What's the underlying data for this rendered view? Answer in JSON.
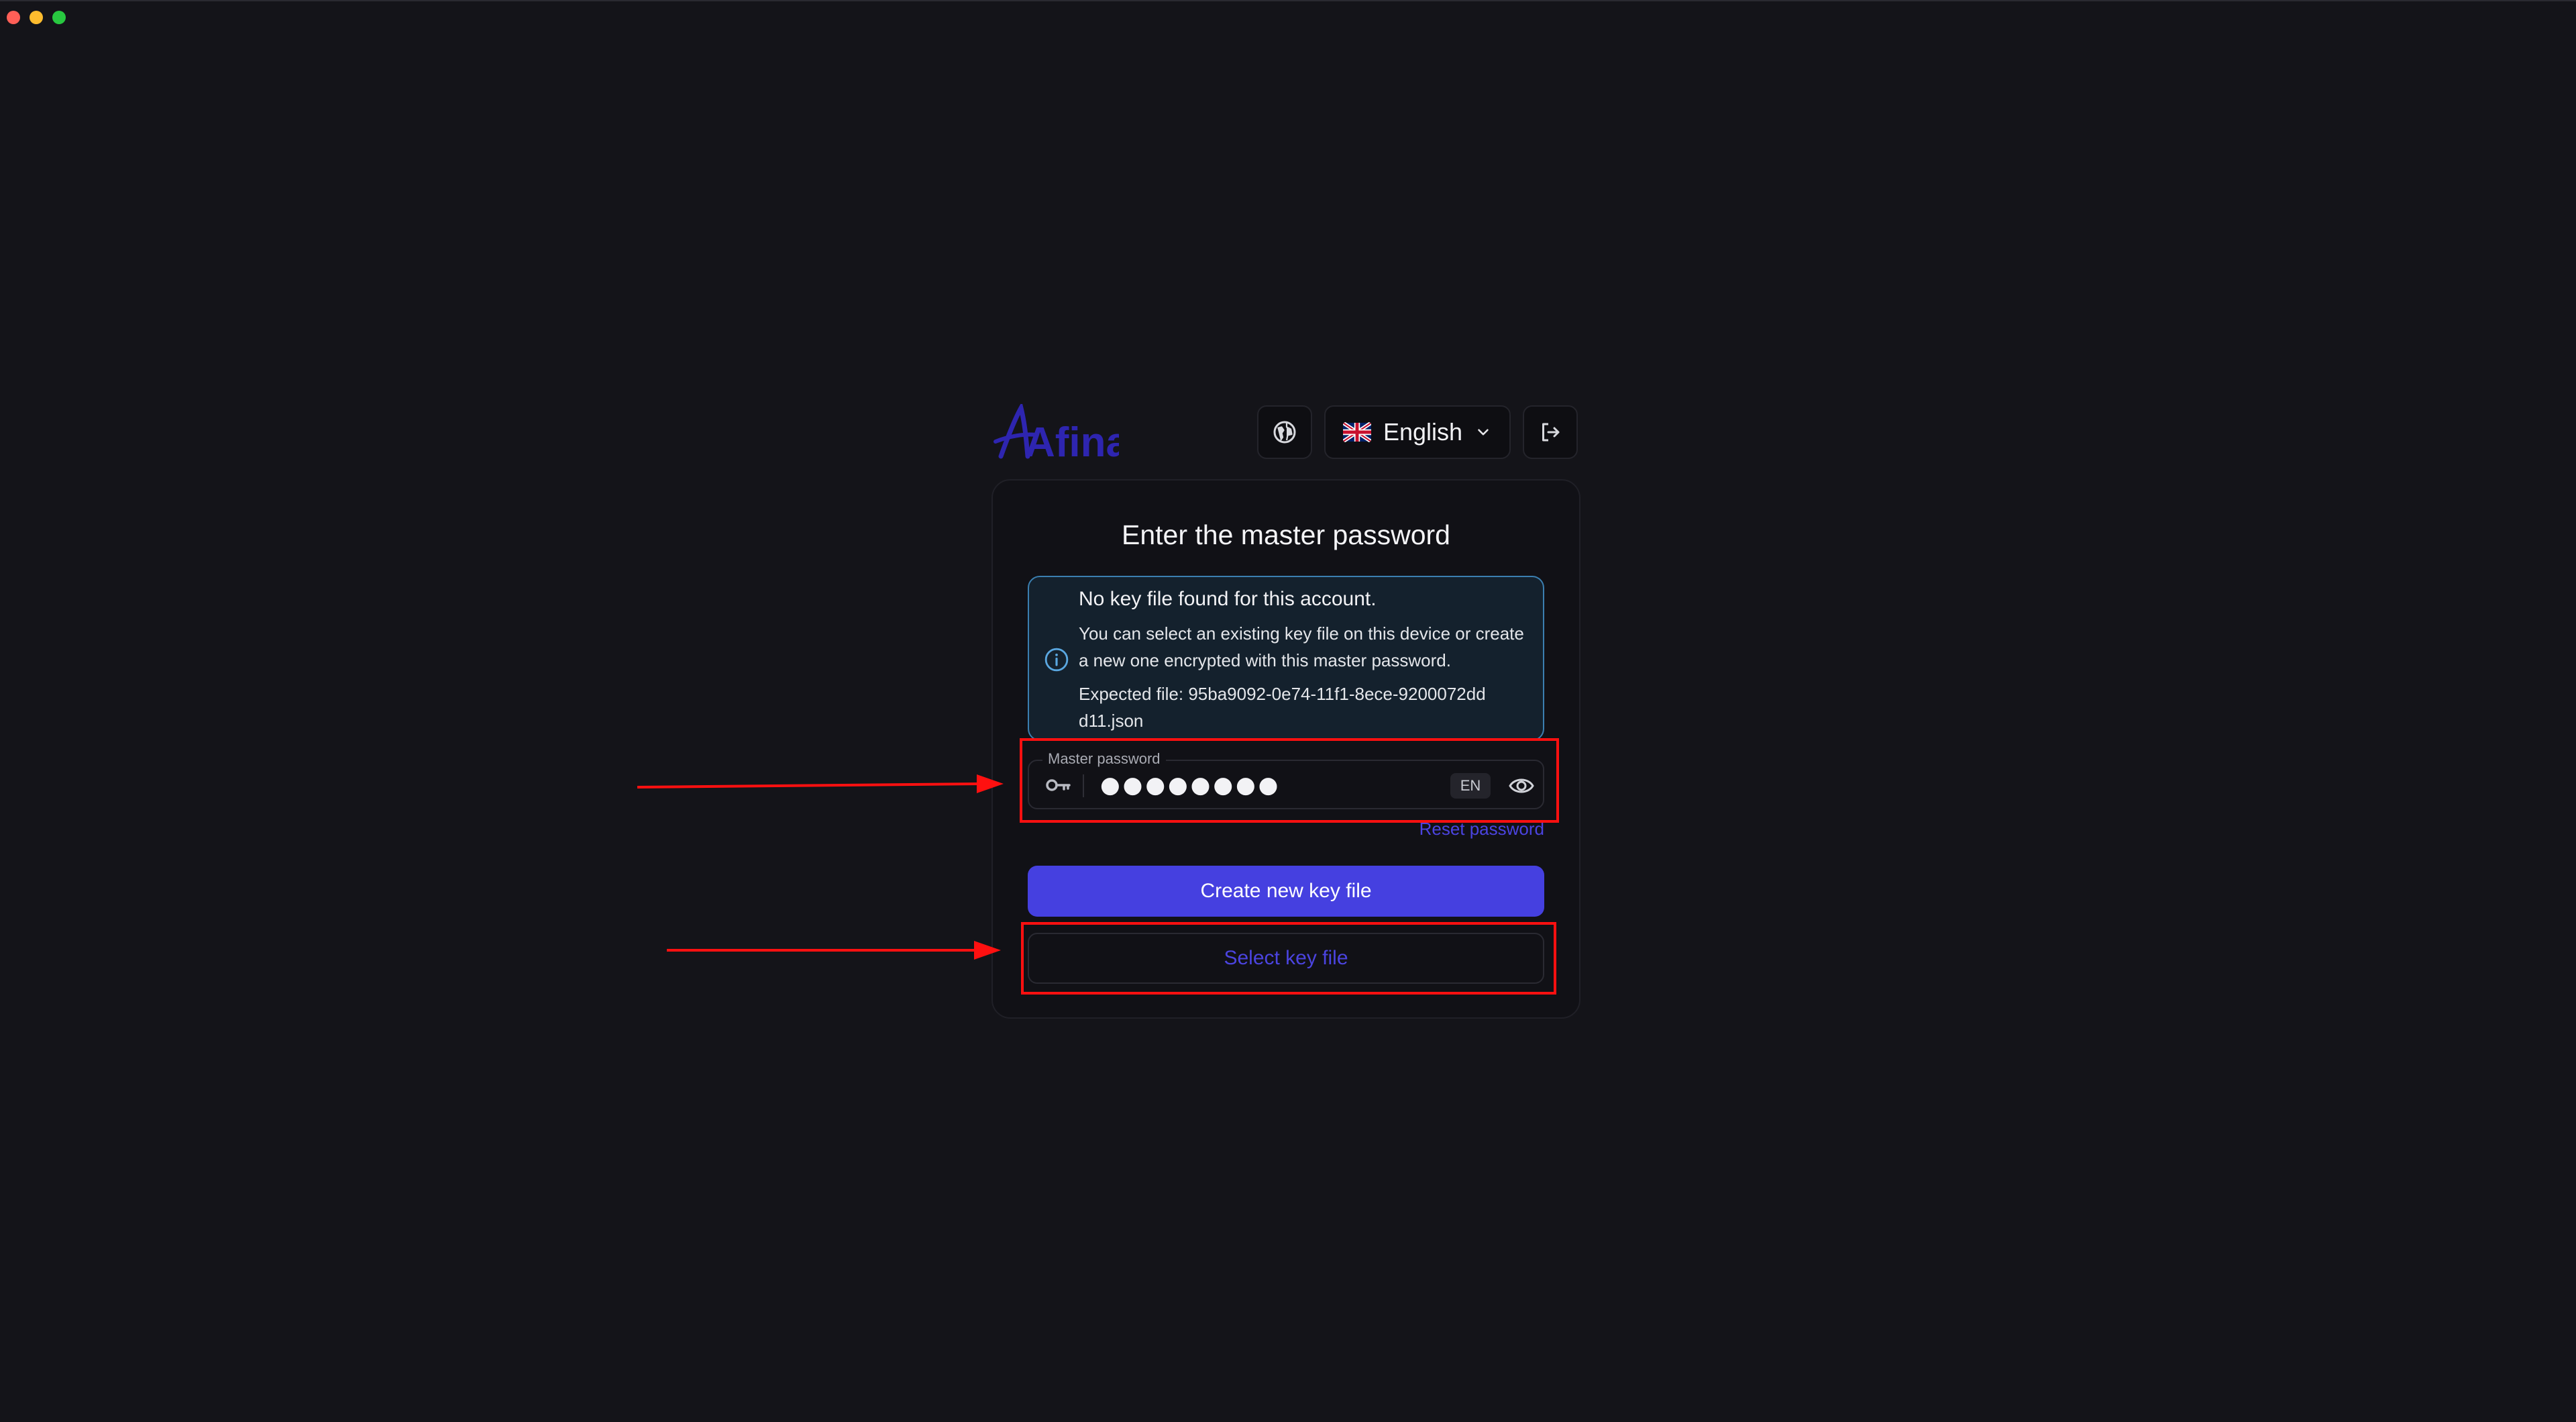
{
  "brand": {
    "logo_text": "Afina",
    "color": "#2e25b0"
  },
  "language": {
    "selected": "English"
  },
  "card": {
    "title": "Enter the master password",
    "alert": {
      "title": "No key file found for this account.",
      "body": "You can select an existing key file on this device or create a new one encrypted with this master password.",
      "expected_file": "Expected file: 95ba9092-0e74-11f1-8ece-9200072ddd11.json"
    },
    "password": {
      "label": "Master password",
      "value": "●●●●●●●●",
      "layout_badge": "EN"
    },
    "reset_label": "Reset password",
    "create_label": "Create new key file",
    "select_label": "Select key file"
  },
  "colors": {
    "accent": "#4540e0",
    "annotation": "#ff1010",
    "info_border": "#3b7fb0"
  },
  "icons": [
    "globe-icon",
    "chevron-down-icon",
    "logout-icon",
    "info-icon",
    "key-icon",
    "eye-icon",
    "uk-flag-icon"
  ]
}
